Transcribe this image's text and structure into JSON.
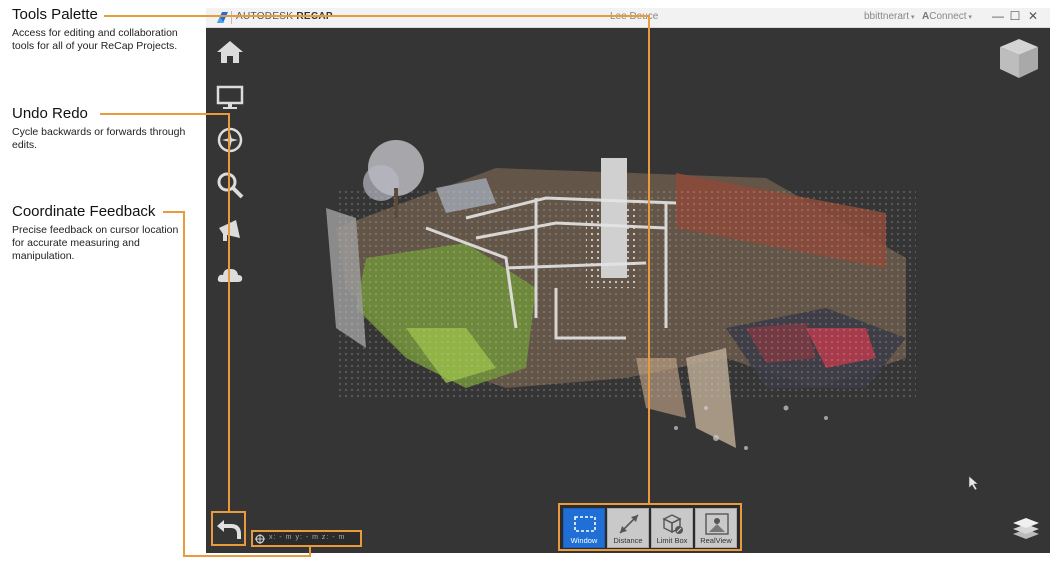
{
  "callouts": {
    "tools_palette": {
      "title": "Tools Palette",
      "desc": "Access for editing and collaboration tools for all of your ReCap Projects."
    },
    "undo_redo": {
      "title": "Undo Redo",
      "desc": "Cycle backwards or forwards through edits."
    },
    "coordinate_feedback": {
      "title": "Coordinate Feedback",
      "desc": "Precise feedback on cursor location for accurate measuring and manipulation."
    }
  },
  "titlebar": {
    "brand_prefix": "AUTODESK",
    "brand_name": "RECAP",
    "project": "Lee Deuce",
    "user": "bbittnerart",
    "connect": "Connect",
    "minimize": "—",
    "maximize": "☐",
    "close": "✕"
  },
  "left_toolbar": [
    "home-icon",
    "display-settings-icon",
    "navigation-compass-icon",
    "search-icon",
    "announce-icon",
    "cloud-icon"
  ],
  "bottom_tools": {
    "window": "Window",
    "distance": "Distance",
    "limit_box": "Limit Box",
    "realview": "RealView"
  },
  "coordinates": {
    "text": "x: - m  y: - m  z: - m"
  },
  "colors": {
    "accent": "#e89a3c",
    "viewport": "#353535",
    "active_tool": "#1f6fd6"
  }
}
